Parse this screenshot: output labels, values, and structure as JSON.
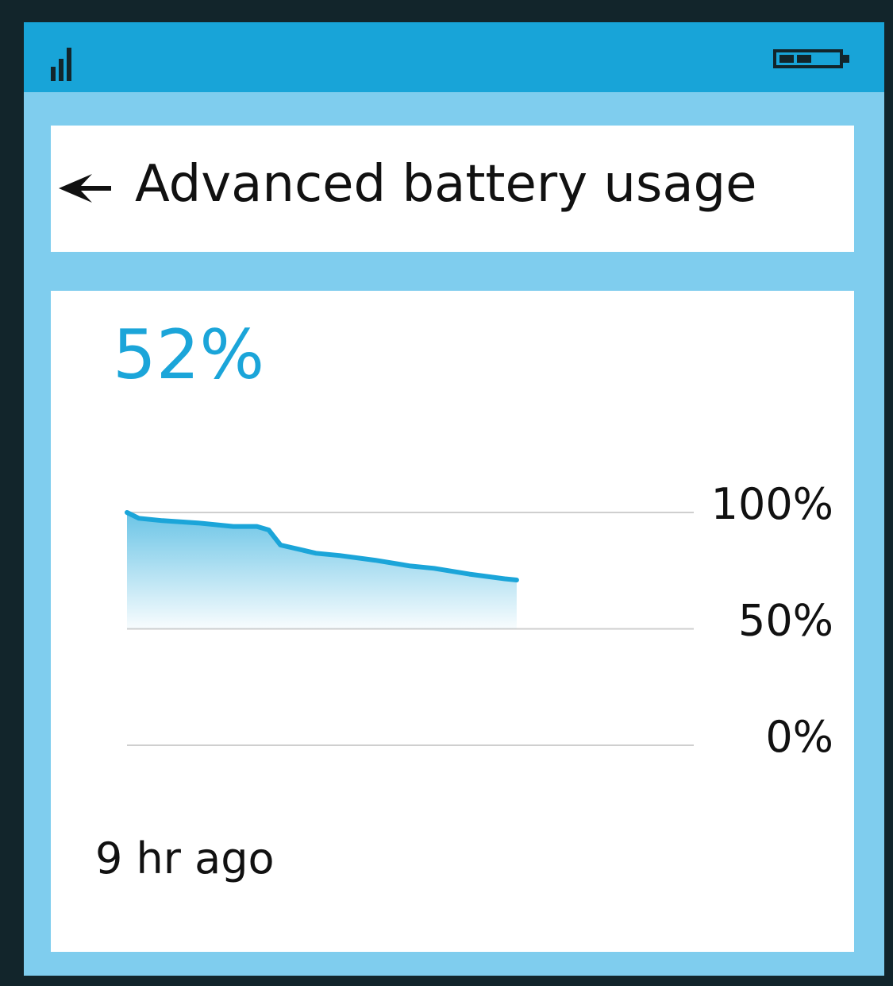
{
  "status_bar": {
    "signal_icon": "signal-bars-icon",
    "battery_icon": "battery-icon",
    "color": "#18a4d8"
  },
  "header": {
    "back_icon": "back-arrow-icon",
    "title": "Advanced battery usage"
  },
  "battery": {
    "percent_label": "52%",
    "accent_color": "#1ba5d9"
  },
  "history": {
    "start_label": "9 hr ago"
  },
  "chart_data": {
    "type": "area",
    "x_unit": "hours",
    "x_range": [
      0,
      24
    ],
    "x": [
      0,
      0.5,
      1.5,
      3,
      4.5,
      5.5,
      6,
      6.5,
      8,
      9,
      10.5,
      12,
      13,
      14.5,
      16,
      16.5
    ],
    "y": [
      100,
      97.5,
      96.5,
      95.5,
      94,
      94,
      92.5,
      86,
      82.5,
      81.5,
      79.5,
      77,
      76,
      73.5,
      71.5,
      71
    ],
    "ylim": [
      0,
      100
    ],
    "y_ticks": [
      {
        "value": 100,
        "label": "100%"
      },
      {
        "value": 50,
        "label": "50%"
      },
      {
        "value": 0,
        "label": "0%"
      }
    ],
    "grid": true,
    "line_color": "#1ba5d9",
    "fill_color": "#1ba5d9"
  }
}
